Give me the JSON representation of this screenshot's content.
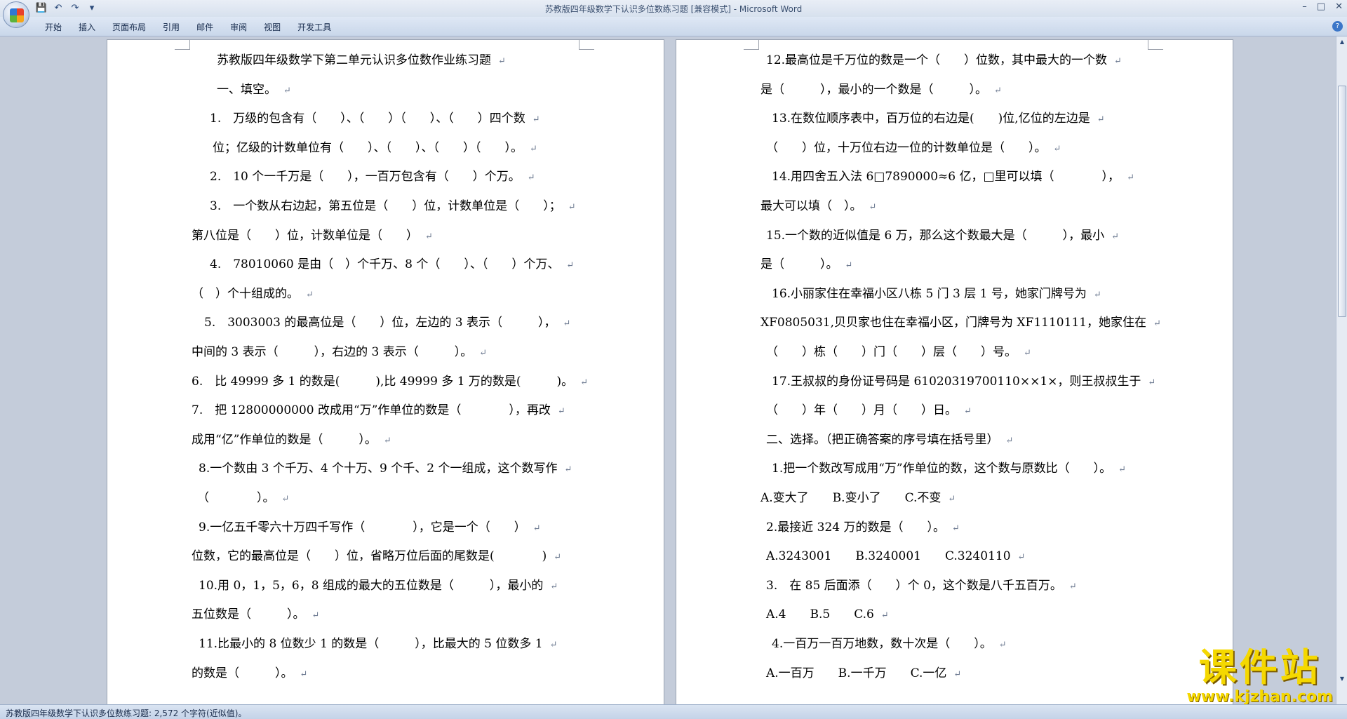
{
  "window": {
    "title": "苏教版四年级数学下认识多位数练习题 [兼容模式] - Microsoft Word",
    "controls": [
      "–",
      "□",
      "✕"
    ]
  },
  "qat": {
    "icons": [
      "save-icon",
      "undo-icon",
      "redo-icon",
      "customize-icon"
    ],
    "glyphs": [
      "💾",
      "↶",
      "↷",
      "▾"
    ]
  },
  "ribbon": {
    "tabs": [
      "开始",
      "插入",
      "页面布局",
      "引用",
      "邮件",
      "审阅",
      "视图",
      "开发工具"
    ]
  },
  "left_page": {
    "lines": [
      "苏教版四年级数学下第二单元认识多位数作业练习题",
      "一、填空。",
      "1.　万级的包含有（　　）、（　　）（　　）、（　　）四个数",
      "位；亿级的计数单位有（　　）、（　　）、（　　）（　　）。",
      "2.　10 个一千万是（　　），一百万包含有（　　）个万。",
      "3.　一个数从右边起，第五位是（　　）位，计数单位是（　　）；",
      "第八位是（　　）位，计数单位是（　　）",
      "4.　78010060 是由（　）个千万、8 个（　　）、（　　）个万、",
      "（　）个十组成的。",
      "5.　3003003 的最高位是（　　）位，左边的 3 表示（　　　），",
      "中间的 3 表示（　　　），右边的 3 表示（　　　）。",
      "6.　比 49999 多 1 的数是(　　　),比 49999 多 1 万的数是(　　　)。",
      "7.　把 12800000000 改成用“万”作单位的数是（　　　　），再改",
      "成用“亿”作单位的数是（　　　）。",
      "8.一个数由 3 个千万、4 个十万、9 个千、2 个一组成，这个数写作",
      "（　　　　）。",
      "9.一亿五千零六十万四千写作（　　　　），它是一个（　　）",
      "位数，它的最高位是（　　）位，省略万位后面的尾数是(　　　　)",
      "10.用 0，1，5，6，8 组成的最大的五位数是（　　　），最小的",
      "五位数是（　　　）。",
      "11.比最小的 8 位数少 1 的数是（　　　），比最大的 5 位数多 1",
      "的数是（　　　）。"
    ]
  },
  "right_page": {
    "lines": [
      "12.最高位是千万位的数是一个（　　）位数，其中最大的一个数",
      "是（　　　），最小的一个数是（　　　）。",
      "13.在数位顺序表中，百万位的右边是(　　)位,亿位的左边是",
      "（　　）位，十万位右边一位的计数单位是（　　）。",
      "14.用四舍五入法 6□7890000≈6 亿，□里可以填（　　　　），",
      "最大可以填（　）。",
      "15.一个数的近似值是 6 万，那么这个数最大是（　　　），最小",
      "是（　　　）。",
      "16.小丽家住在幸福小区八栋 5 门 3 层 1 号，她家门牌号为",
      "XF0805031,贝贝家也住在幸福小区，门牌号为 XF1110111，她家住在",
      "（　　）栋（　　）门（　　）层（　　）号。",
      "17.王叔叔的身份证号码是 61020319700110××1×，则王叔叔生于",
      "（　　）年（　　）月（　　）日。",
      "二、选择。（把正确答案的序号填在括号里）",
      "1.把一个数改写成用“万”作单位的数，这个数与原数比（　　）。",
      "A.变大了　　B.变小了　　C.不变",
      "2.最接近 324 万的数是（　　）。",
      "A.3243001　　B.3240001　　C.3240110",
      "3.　在 85 后面添（　　）个 0，这个数是八千五百万。",
      "A.4　　B.5　　C.6",
      "4.一百万一百万地数，数十次是（　　）。",
      "A.一百万　　B.一千万　　C.一亿"
    ]
  },
  "paragraph_mark": "↵",
  "statusbar": {
    "text": "苏教版四年级数学下认识多位数练习题: 2,572 个字符(近似值)。"
  },
  "watermark": {
    "title": "课件站",
    "url": "www.kjzhan.com"
  }
}
